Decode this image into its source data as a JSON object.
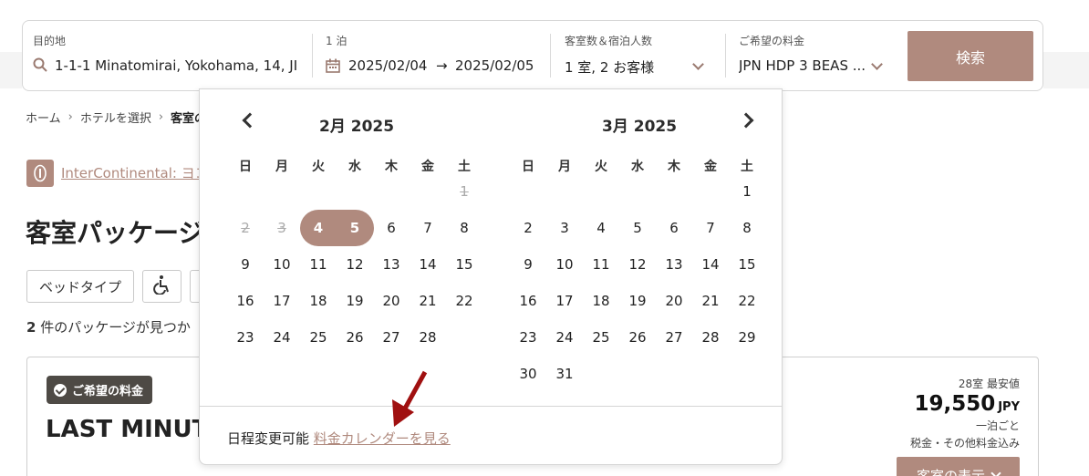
{
  "search": {
    "destination_label": "目的地",
    "destination_value": "1-1-1 Minatomirai, Yokohama, 14, JI",
    "nights_label": "1 泊",
    "checkin": "2025/02/04",
    "checkout": "2025/02/05",
    "date_arrow": "→",
    "guests_label": "客室数＆宿泊人数",
    "guests_value": "1 室, 2 お客様",
    "rate_label": "ご希望の料金",
    "rate_value": "JPN HDP 3 BEAS ...",
    "search_button": "検索"
  },
  "breadcrumb": {
    "home": "ホーム",
    "select_hotel": "ホテルを選択",
    "current": "客室の"
  },
  "brand": {
    "link": "InterContinental: ヨコ"
  },
  "page_title": "客室パッケージ",
  "filters": {
    "bed_type": "ベッドタイプ"
  },
  "results": {
    "count": "2",
    "count_text": " 件のパッケージが見つか"
  },
  "card": {
    "badge": "ご希望の料金",
    "title": "LAST MINUT",
    "rooms_left": "28室 最安値",
    "price": "19,550",
    "currency": "JPY",
    "per_night": "一泊ごと",
    "tax": "税金・その他料金込み",
    "view_button": "客室の表示"
  },
  "calendar": {
    "left_month": "2月 2025",
    "right_month": "3月 2025",
    "weekdays": [
      "日",
      "月",
      "火",
      "水",
      "木",
      "金",
      "土"
    ],
    "left_days": [
      [
        null,
        null,
        null,
        null,
        null,
        null,
        "1"
      ],
      [
        "2",
        "3",
        "4",
        "5",
        "6",
        "7",
        "8"
      ],
      [
        "9",
        "10",
        "11",
        "12",
        "13",
        "14",
        "15"
      ],
      [
        "16",
        "17",
        "18",
        "19",
        "20",
        "21",
        "22"
      ],
      [
        "23",
        "24",
        "25",
        "26",
        "27",
        "28",
        null
      ]
    ],
    "right_days": [
      [
        null,
        null,
        null,
        null,
        null,
        null,
        "1"
      ],
      [
        "2",
        "3",
        "4",
        "5",
        "6",
        "7",
        "8"
      ],
      [
        "9",
        "10",
        "11",
        "12",
        "13",
        "14",
        "15"
      ],
      [
        "16",
        "17",
        "18",
        "19",
        "20",
        "21",
        "22"
      ],
      [
        "23",
        "24",
        "25",
        "26",
        "27",
        "28",
        "29"
      ],
      [
        "30",
        "31",
        null,
        null,
        null,
        null,
        null
      ]
    ],
    "past_days": [
      "1",
      "2",
      "3"
    ],
    "selected_days": [
      "4",
      "5"
    ],
    "flex_text": "日程変更可能",
    "flex_link": "料金カレンダーを見る"
  },
  "colors": {
    "accent": "#b08a7e",
    "badge": "#4e4a45",
    "annotation_arrow": "#a01010"
  },
  "icons": {
    "search": "search-icon",
    "calendar": "calendar-icon",
    "chevron": "chevron-down-icon",
    "wheelchair": "wheelchair-icon",
    "brand": "intercontinental-logo-icon"
  }
}
